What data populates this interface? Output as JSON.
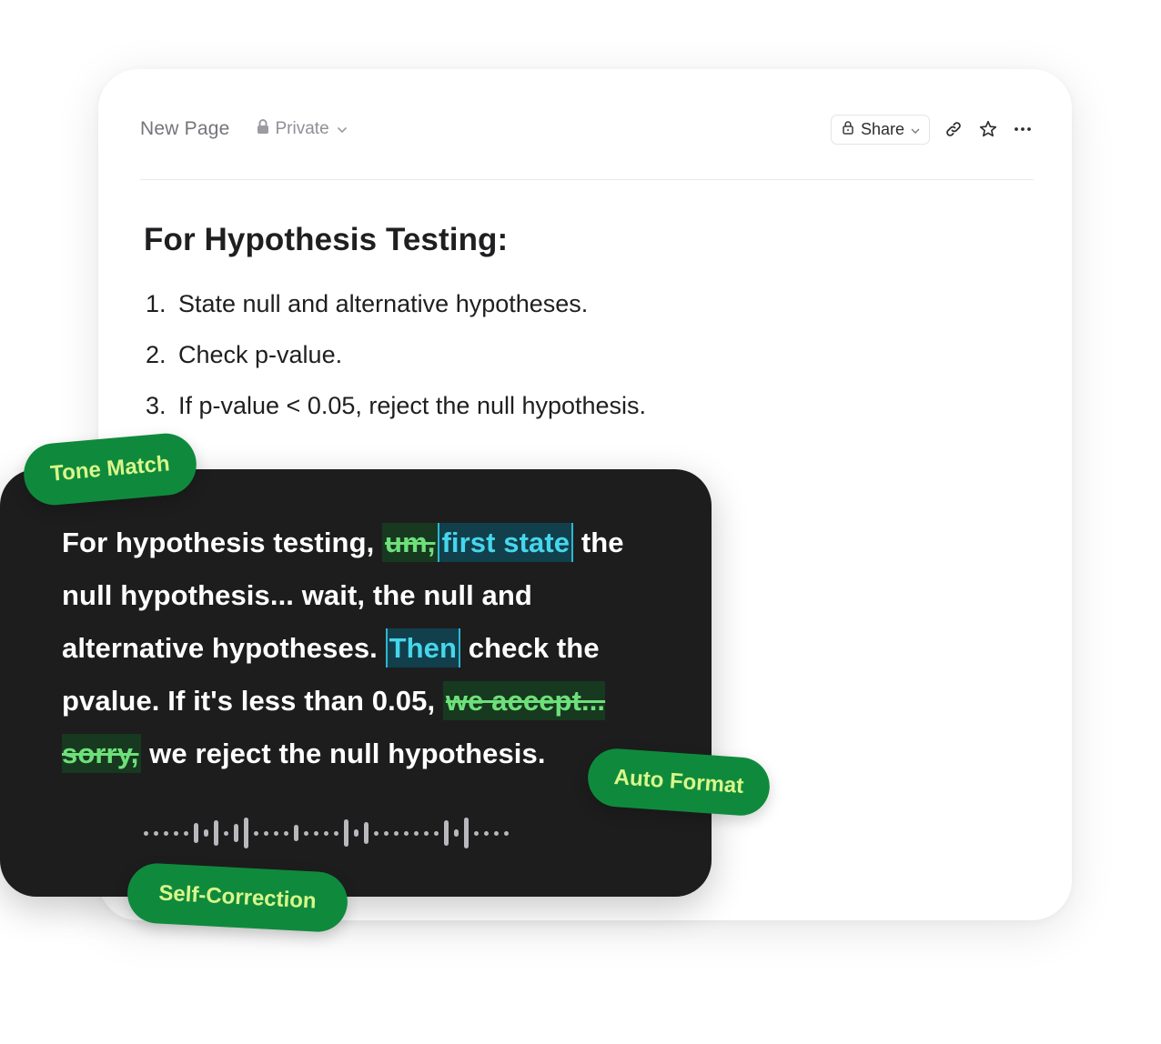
{
  "page": {
    "title": "New Page",
    "privacy_label": "Private",
    "share_label": "Share"
  },
  "icons": {
    "privacy": "lock-icon",
    "privacy_dropdown": "chevron-down-icon",
    "share_lock": "lock-icon",
    "share_dropdown": "chevron-down-icon",
    "copy_link": "link-icon",
    "favorite": "star-icon",
    "more": "more-horizontal-icon"
  },
  "doc": {
    "heading": "For Hypothesis Testing:",
    "items": [
      {
        "num": "1.",
        "text": "State null and alternative hypotheses."
      },
      {
        "num": "2.",
        "text": "Check p-value."
      },
      {
        "num": "3.",
        "text": "If p-value < 0.05, reject the null hypothesis."
      }
    ]
  },
  "transcript": {
    "s1": "For hypothesis testing, ",
    "strike1": "um,",
    "insert1": "first state",
    "s2": " the null hypothesis... wait, the null and alternative hypotheses. ",
    "insert2": "Then",
    "s3": " check the pvalue. If it's less than 0.05, ",
    "strike2": "we accept... sorry,",
    "s4": " we reject the null hypothesis."
  },
  "tags": {
    "tone_match": "Tone Match",
    "auto_format": "Auto Format",
    "self_correction": "Self-Correction"
  },
  "colors": {
    "tag_bg": "#0f8a3c",
    "tag_text": "#d9f78a",
    "strike_text": "#6ee07a",
    "insert_text": "#46d6ec",
    "dark_card": "#1d1d1e"
  }
}
